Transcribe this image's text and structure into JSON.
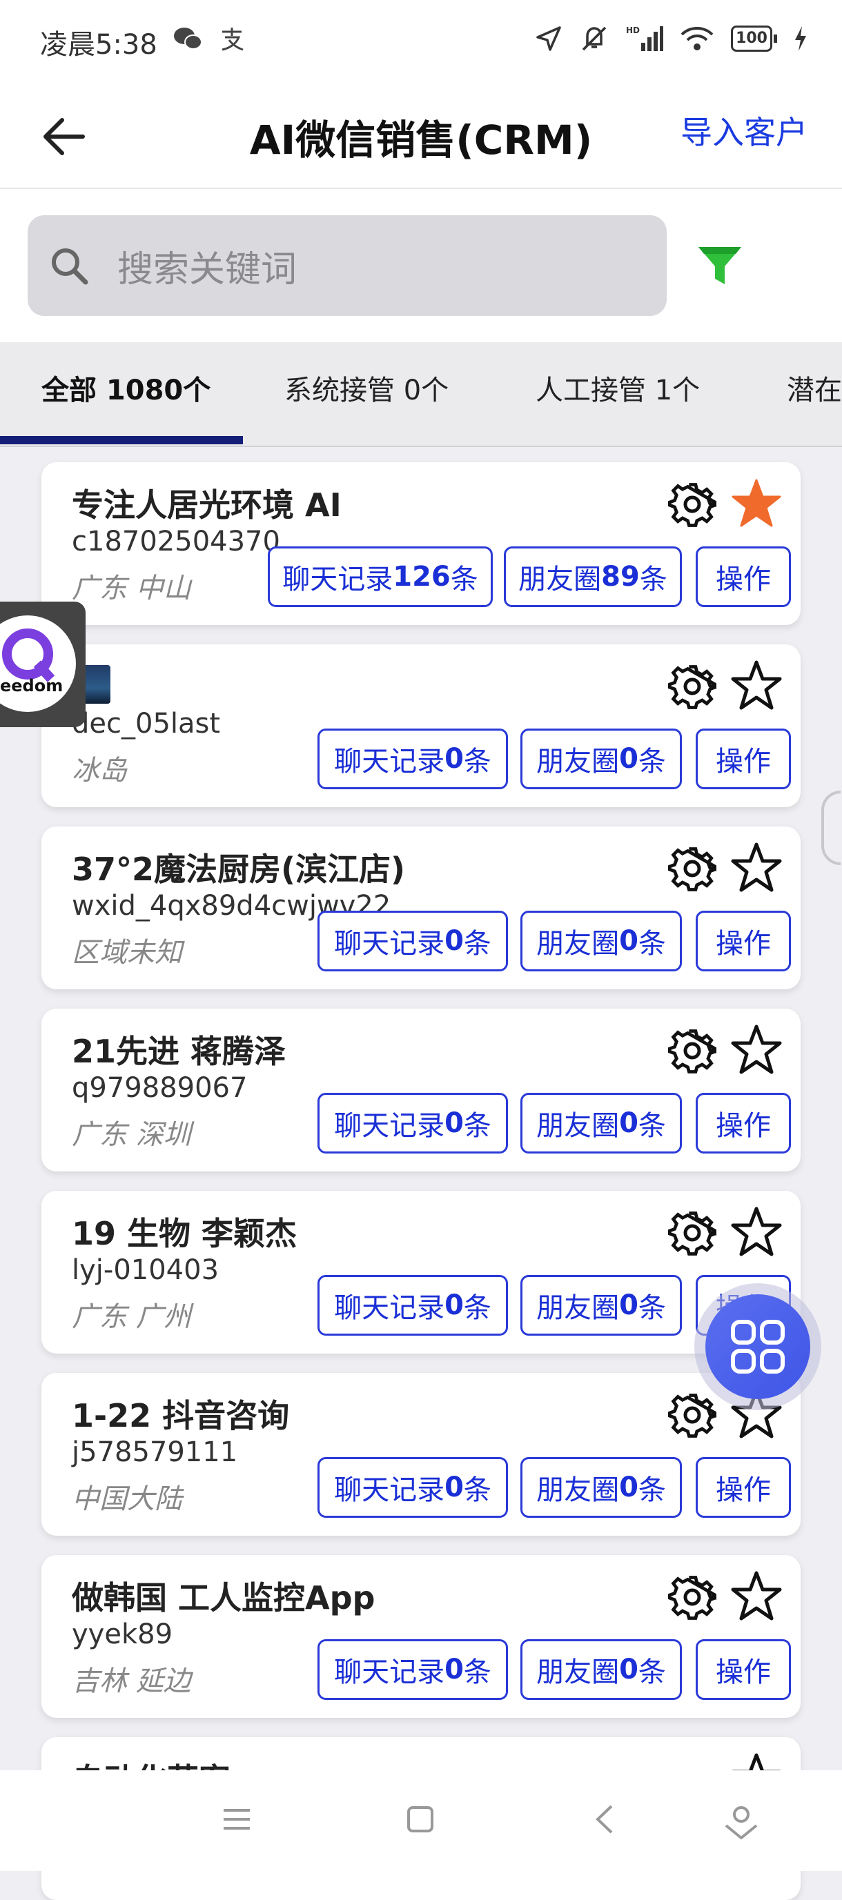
{
  "status": {
    "time": "凌晨5:38",
    "battery": "100"
  },
  "header": {
    "title": "AI微信销售(CRM)",
    "import_label": "导入客户"
  },
  "search": {
    "placeholder": "搜索关键词"
  },
  "tabs": [
    {
      "label": "全部 1080个",
      "active": true
    },
    {
      "label": "系统接管 0个",
      "active": false
    },
    {
      "label": "人工接管 1个",
      "active": false
    },
    {
      "label": "潜在",
      "active": false
    }
  ],
  "floating_logo": {
    "text": "eedom"
  },
  "customers": [
    {
      "name": "专注人居光环境 AI",
      "id": "c18702504370",
      "location": "广东  中山",
      "chat_prefix": "聊天记录",
      "chat_count": "126",
      "moments_prefix": "朋友圈",
      "moments_count": "89",
      "suffix": "条",
      "action": "操作",
      "starred": true
    },
    {
      "name": "",
      "id": "dec_05last",
      "location": "冰岛",
      "chat_prefix": "聊天记录",
      "chat_count": "0",
      "moments_prefix": "朋友圈",
      "moments_count": "0",
      "suffix": "条",
      "action": "操作",
      "starred": false
    },
    {
      "name": "37°2魔法厨房(滨江店)",
      "id": "wxid_4qx89d4cwjwv22",
      "location": "区域未知",
      "chat_prefix": "聊天记录",
      "chat_count": "0",
      "moments_prefix": "朋友圈",
      "moments_count": "0",
      "suffix": "条",
      "action": "操作",
      "starred": false
    },
    {
      "name": "21先进 蒋腾泽",
      "id": "q979889067",
      "location": "广东  深圳",
      "chat_prefix": "聊天记录",
      "chat_count": "0",
      "moments_prefix": "朋友圈",
      "moments_count": "0",
      "suffix": "条",
      "action": "操作",
      "starred": false
    },
    {
      "name": "19 生物 李颖杰",
      "id": "lyj-010403",
      "location": "广东  广州",
      "chat_prefix": "聊天记录",
      "chat_count": "0",
      "moments_prefix": "朋友圈",
      "moments_count": "0",
      "suffix": "条",
      "action": "操作",
      "starred": false
    },
    {
      "name": "1-22 抖音咨询",
      "id": "j578579111",
      "location": "中国大陆",
      "chat_prefix": "聊天记录",
      "chat_count": "0",
      "moments_prefix": "朋友圈",
      "moments_count": "0",
      "suffix": "条",
      "action": "操作",
      "starred": false
    },
    {
      "name": "做韩国 工人监控App",
      "id": "yyek89",
      "location": "吉林  延边",
      "chat_prefix": "聊天记录",
      "chat_count": "0",
      "moments_prefix": "朋友圈",
      "moments_count": "0",
      "suffix": "条",
      "action": "操作",
      "starred": false
    },
    {
      "name": "自动化获客",
      "id": "",
      "location": "",
      "chat_prefix": "",
      "chat_count": "",
      "moments_prefix": "",
      "moments_count": "",
      "suffix": "",
      "action": "",
      "starred": false
    }
  ],
  "colors": {
    "accent": "#1a2fd6",
    "star_active": "#f06a2c",
    "filter": "#2fbf3a",
    "tab_underline": "#141e78"
  }
}
